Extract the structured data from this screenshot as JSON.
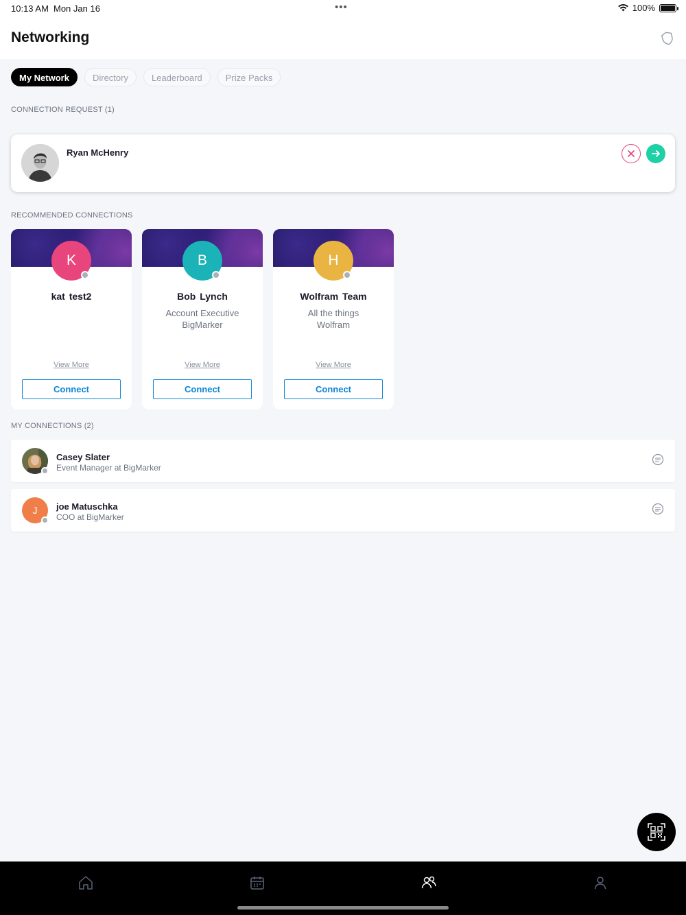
{
  "status_bar": {
    "time": "10:13 AM",
    "date": "Mon Jan 16",
    "battery": "100%"
  },
  "header": {
    "title": "Networking",
    "icon": "shield-badge-icon"
  },
  "tabs": [
    {
      "label": "My Network",
      "active": true
    },
    {
      "label": "Directory",
      "active": false
    },
    {
      "label": "Leaderboard",
      "active": false
    },
    {
      "label": "Prize Packs",
      "active": false
    }
  ],
  "connection_requests": {
    "label": "CONNECTION REQUEST (1)",
    "items": [
      {
        "name": "Ryan McHenry"
      }
    ]
  },
  "recommended": {
    "label": "RECOMMENDED CONNECTIONS",
    "items": [
      {
        "initial": "K",
        "name": "kat  test2",
        "title": "",
        "company": "",
        "color": "#e8457c",
        "view_more": "View More",
        "connect": "Connect"
      },
      {
        "initial": "B",
        "name": "Bob  Lynch",
        "title": "Account Executive",
        "company": "BigMarker",
        "color": "#1bb3b8",
        "view_more": "View More",
        "connect": "Connect"
      },
      {
        "initial": "H",
        "name": "Wolfram Team",
        "title": "All the things",
        "company": "Wolfram",
        "color": "#eab443",
        "view_more": "View More",
        "connect": "Connect"
      }
    ]
  },
  "my_connections": {
    "label": "MY CONNECTIONS (2)",
    "items": [
      {
        "name": "Casey Slater",
        "title": "Event Manager at BigMarker"
      },
      {
        "initial": "J",
        "name": "joe Matuschka",
        "title": "COO at BigMarker"
      }
    ]
  },
  "bottom_nav": [
    "home-icon",
    "calendar-icon",
    "people-icon",
    "profile-icon"
  ],
  "colors": {
    "accent_blue": "#0b86d6",
    "accept_green": "#1fcfa6",
    "decline_pink": "#e2407a"
  }
}
